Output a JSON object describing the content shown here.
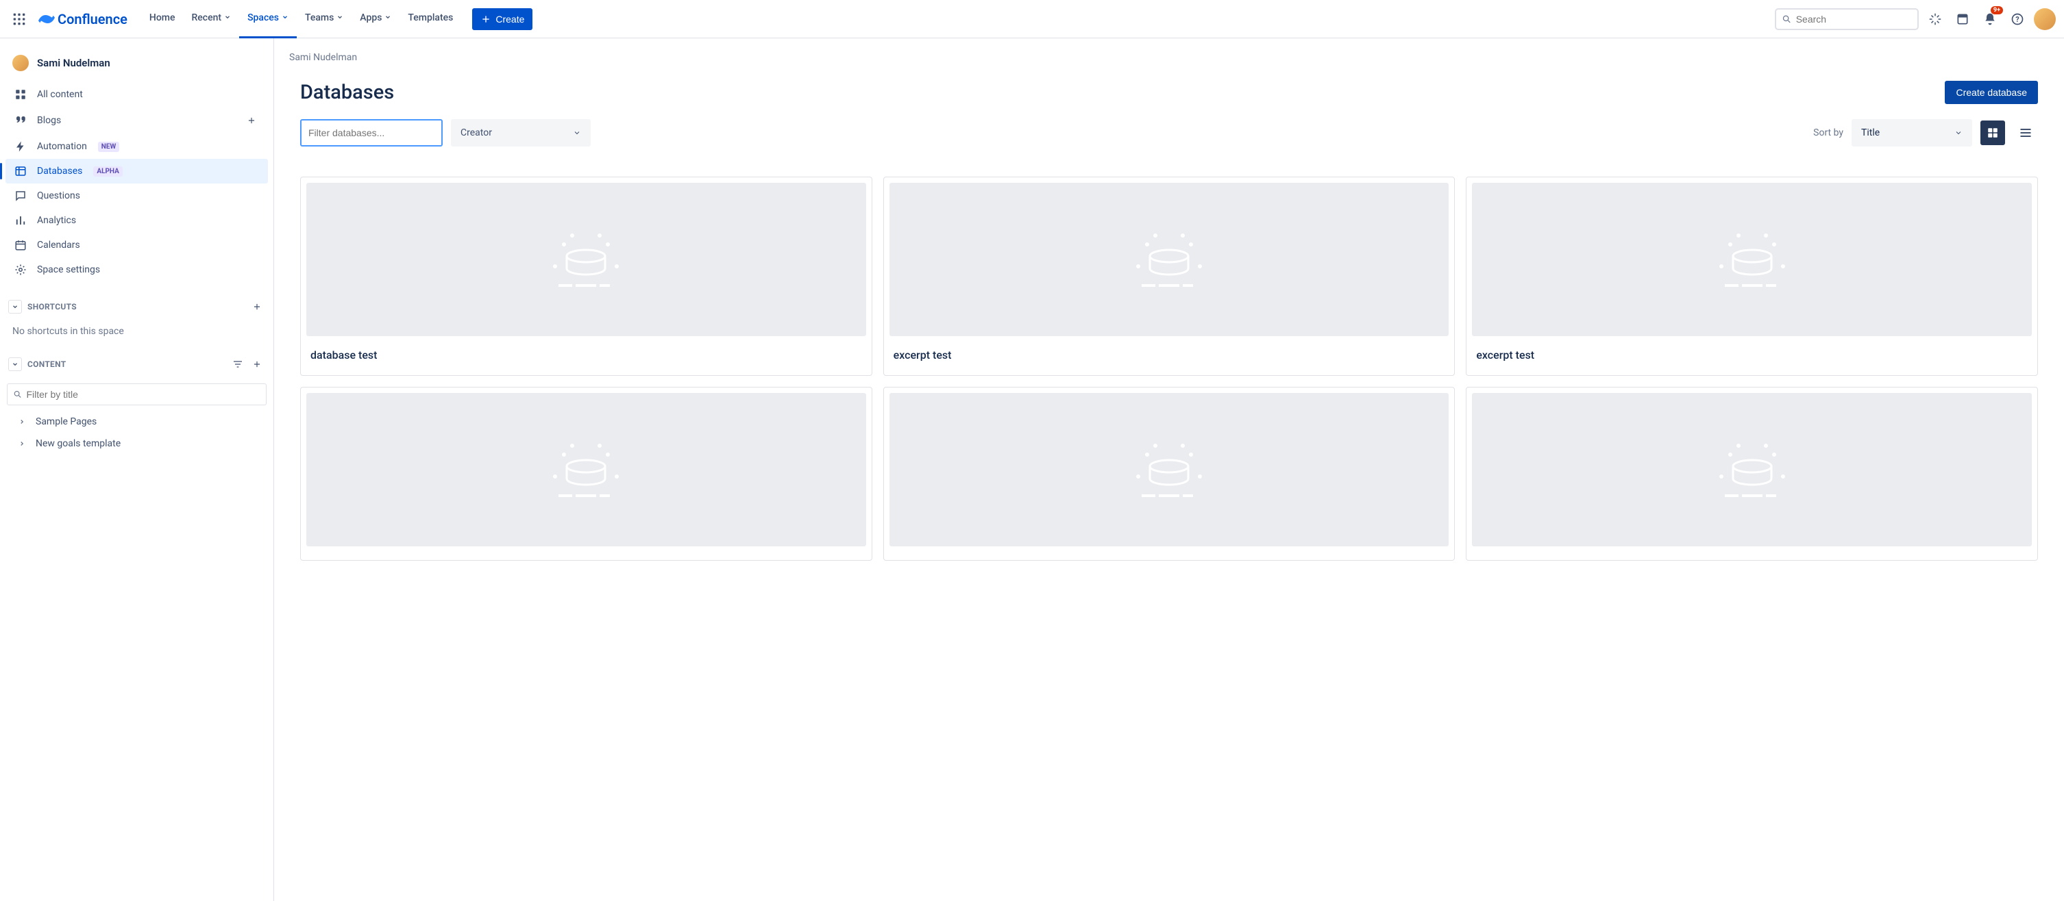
{
  "topnav": {
    "product_name": "Confluence",
    "items": [
      {
        "label": "Home",
        "has_menu": false,
        "active": false
      },
      {
        "label": "Recent",
        "has_menu": true,
        "active": false
      },
      {
        "label": "Spaces",
        "has_menu": true,
        "active": true
      },
      {
        "label": "Teams",
        "has_menu": true,
        "active": false
      },
      {
        "label": "Apps",
        "has_menu": true,
        "active": false
      },
      {
        "label": "Templates",
        "has_menu": false,
        "active": false
      }
    ],
    "create_label": "Create",
    "search_placeholder": "Search",
    "notification_badge": "9+"
  },
  "sidebar": {
    "space_name": "Sami Nudelman",
    "nav": [
      {
        "key": "all-content",
        "label": "All content"
      },
      {
        "key": "blogs",
        "label": "Blogs",
        "add": true
      },
      {
        "key": "automation",
        "label": "Automation",
        "badge": "NEW",
        "badge_class": "badge-new"
      },
      {
        "key": "databases",
        "label": "Databases",
        "badge": "ALPHA",
        "badge_class": "badge-alpha",
        "active": true
      },
      {
        "key": "questions",
        "label": "Questions"
      },
      {
        "key": "analytics",
        "label": "Analytics"
      },
      {
        "key": "calendars",
        "label": "Calendars"
      },
      {
        "key": "space-settings",
        "label": "Space settings"
      }
    ],
    "shortcuts_title": "SHORTCUTS",
    "shortcuts_empty": "No shortcuts in this space",
    "content_title": "CONTENT",
    "filter_placeholder": "Filter by title",
    "tree": [
      {
        "label": "Sample Pages"
      },
      {
        "label": "New goals template"
      }
    ]
  },
  "main": {
    "breadcrumb": "Sami Nudelman",
    "title": "Databases",
    "create_db_label": "Create database",
    "filter_placeholder": "Filter databases...",
    "creator_label": "Creator",
    "sort_by_label": "Sort by",
    "sort_value": "Title",
    "cards": [
      {
        "title": "database test"
      },
      {
        "title": "excerpt test"
      },
      {
        "title": "excerpt test"
      },
      {
        "title": ""
      },
      {
        "title": ""
      },
      {
        "title": ""
      }
    ]
  }
}
